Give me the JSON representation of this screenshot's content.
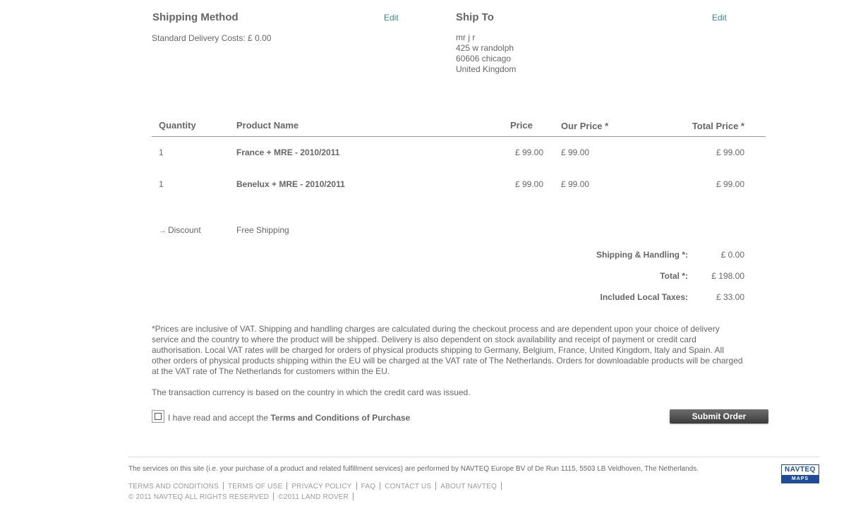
{
  "shipping_method": {
    "title": "Shipping Method",
    "edit_label": "Edit",
    "line": "Standard  Delivery Costs: £ 0.00"
  },
  "ship_to": {
    "title": "Ship To",
    "edit_label": "Edit",
    "address": [
      "mr j r",
      "425 w randolph",
      "60606 chicago",
      "United Kingdom"
    ]
  },
  "table": {
    "headers": {
      "quantity": "Quantity",
      "product": "Product Name",
      "price": "Price",
      "our_price": "Our Price *",
      "total_price": "Total Price *"
    },
    "rows": [
      {
        "quantity": "1",
        "product": "France + MRE - 2010/2011",
        "price": "£ 99.00",
        "our_price": "£ 99.00",
        "total_price": "£ 99.00"
      },
      {
        "quantity": "1",
        "product": "Benelux + MRE - 2010/2011",
        "price": "£ 99.00",
        "our_price": "£ 99.00",
        "total_price": "£ 99.00"
      }
    ]
  },
  "discount": {
    "label": "Discount",
    "value": "Free Shipping"
  },
  "totals": {
    "shipping_label": "Shipping & Handling *:",
    "shipping_value": "£ 0.00",
    "total_label": "Total *:",
    "total_value": "£ 198.00",
    "taxes_label": "Included Local Taxes:",
    "taxes_value": "£ 33.00"
  },
  "notes": {
    "vat": "*Prices are inclusive of VAT. Shipping and handling charges are calculated during the checkout process and are dependent upon your choice of delivery service and the country to where the product will be shipped. Delivery is also dependent on stock availability and receipt of payment or credit card authorisation. Local VAT rates will be charged for orders of physical products shipping to Germany, Belgium, France, United Kingdom, Italy and Spain. All other orders of physical products shipping within the EU will be charged at the VAT rate of The Netherlands. Orders for downloadable products will be charged at the VAT rate of The Netherlands for customers within the EU.",
    "currency": "The transaction currency is based on the country in which the credit card was issued."
  },
  "terms": {
    "prefix": "I have read and accept the ",
    "link": "Terms and Conditions of Purchase"
  },
  "submit_label": "Submit Order",
  "footer": {
    "services": "The services on this site (i.e. your purchase of a product and related fulfillment services) are performed by NAVTEQ Europe BV of De Run 1115, 5503 LB Veldhoven, The Netherlands.",
    "links": [
      "TERMS AND CONDITIONS",
      "TERMS OF USE",
      "PRIVACY POLICY",
      "FAQ",
      "CONTACT US",
      "ABOUT NAVTEQ"
    ],
    "copyright": [
      "© 2011 NAVTEQ ALL RIGHTS RESERVED",
      "©2011 LAND ROVER"
    ],
    "logo_top": "NAVTEQ",
    "logo_bottom": "MAPS"
  },
  "colors": {
    "link": "#3a8a86",
    "text": "#666666",
    "arrow": "#e06a2a",
    "logo": "#1d4c9a"
  }
}
